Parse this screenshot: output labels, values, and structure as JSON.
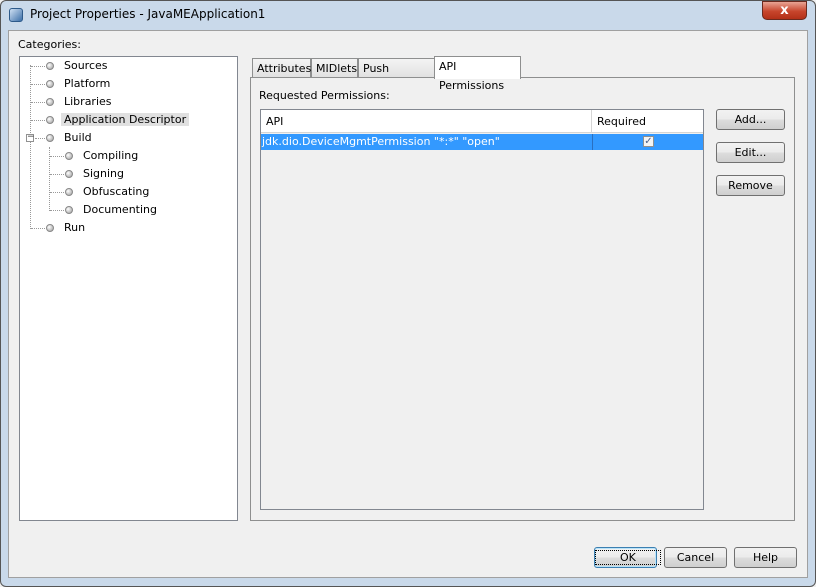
{
  "window": {
    "title": "Project Properties - JavaMEApplication1",
    "close_label": "x"
  },
  "categories": {
    "label": "Categories:",
    "items": [
      {
        "label": "Sources",
        "level": 0
      },
      {
        "label": "Platform",
        "level": 0
      },
      {
        "label": "Libraries",
        "level": 0
      },
      {
        "label": "Application Descriptor",
        "level": 0,
        "selected": true
      },
      {
        "label": "Build",
        "level": 0,
        "expanded": true
      },
      {
        "label": "Compiling",
        "level": 1
      },
      {
        "label": "Signing",
        "level": 1
      },
      {
        "label": "Obfuscating",
        "level": 1
      },
      {
        "label": "Documenting",
        "level": 1
      },
      {
        "label": "Run",
        "level": 0
      }
    ],
    "expander_symbol": "−"
  },
  "tabs": [
    {
      "label": "Attributes"
    },
    {
      "label": "MIDlets"
    },
    {
      "label": "Push Registry"
    },
    {
      "label": "API Permissions",
      "active": true
    }
  ],
  "permissions": {
    "label": "Requested Permissions:",
    "columns": [
      "API",
      "Required"
    ],
    "rows": [
      {
        "api": "jdk.dio.DeviceMgmtPermission \"*:*\" \"open\"",
        "required": true,
        "selected": true
      }
    ],
    "check_glyph": "✓"
  },
  "side_buttons": {
    "add": "Add...",
    "edit": "Edit...",
    "remove": "Remove"
  },
  "footer_buttons": {
    "ok": "OK",
    "cancel": "Cancel",
    "help": "Help"
  }
}
